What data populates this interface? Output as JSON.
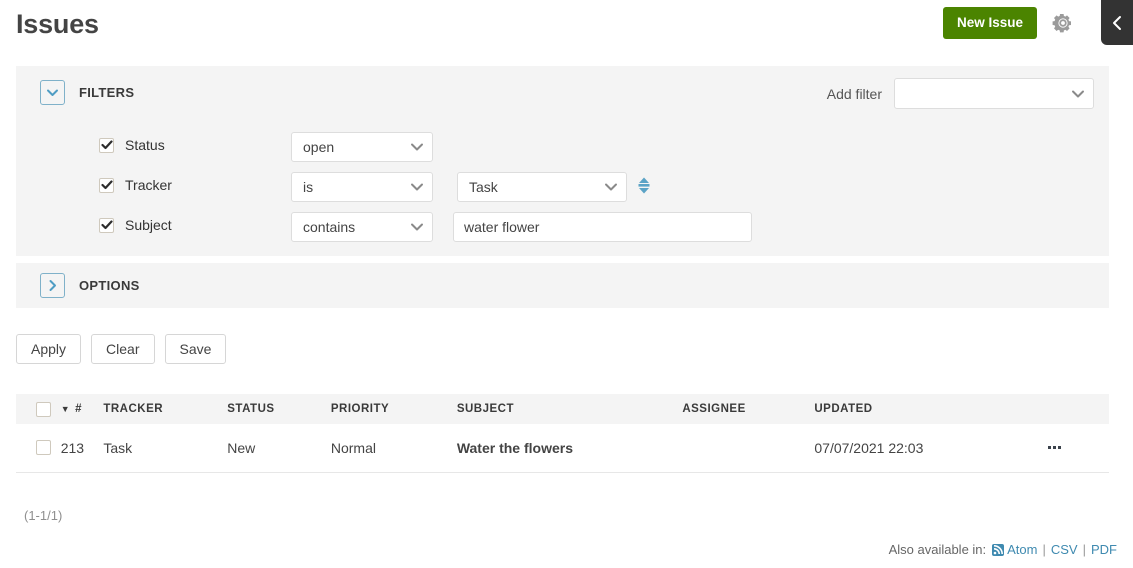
{
  "header": {
    "title": "Issues",
    "new_issue_label": "New Issue",
    "gear_icon": "gear-icon",
    "sidebar_toggle_icon": "chevron-left-icon",
    "new_issue_color": "#4b8400"
  },
  "filters_panel": {
    "legend": "FILTERS",
    "toggle_icon": "chevron-down-icon",
    "add_filter_label": "Add filter",
    "add_filter_value": "",
    "rows": [
      {
        "name": "Status",
        "checked": true,
        "operator": "open",
        "value_type": "none",
        "value": ""
      },
      {
        "name": "Tracker",
        "checked": true,
        "operator": "is",
        "value_type": "select",
        "value": "Task",
        "multi_toggle_icon": "sort-updown-icon"
      },
      {
        "name": "Subject",
        "checked": true,
        "operator": "contains",
        "value_type": "text",
        "value": "water flower",
        "placeholder": ""
      }
    ]
  },
  "options_panel": {
    "legend": "OPTIONS",
    "toggle_icon": "chevron-right-icon"
  },
  "actions": {
    "apply": "Apply",
    "clear": "Clear",
    "save": "Save"
  },
  "table": {
    "columns": [
      "",
      "#",
      "TRACKER",
      "STATUS",
      "PRIORITY",
      "SUBJECT",
      "ASSIGNEE",
      "UPDATED",
      ""
    ],
    "sort_indicator": "▼",
    "rows": [
      {
        "selected": false,
        "id": "213",
        "tracker": "Task",
        "status": "New",
        "priority": "Normal",
        "subject": "Water the flowers",
        "assignee": "",
        "updated": "07/07/2021 22:03",
        "actions_icon": "ellipsis-icon"
      }
    ]
  },
  "pagination": {
    "range": "(1-1/1)"
  },
  "footer": {
    "label": "Also available in:",
    "rss_icon": "rss-icon",
    "atom": "Atom",
    "sep1": "|",
    "csv": "CSV",
    "sep2": "|",
    "pdf": "PDF",
    "link_color": "#3f8ab0"
  }
}
